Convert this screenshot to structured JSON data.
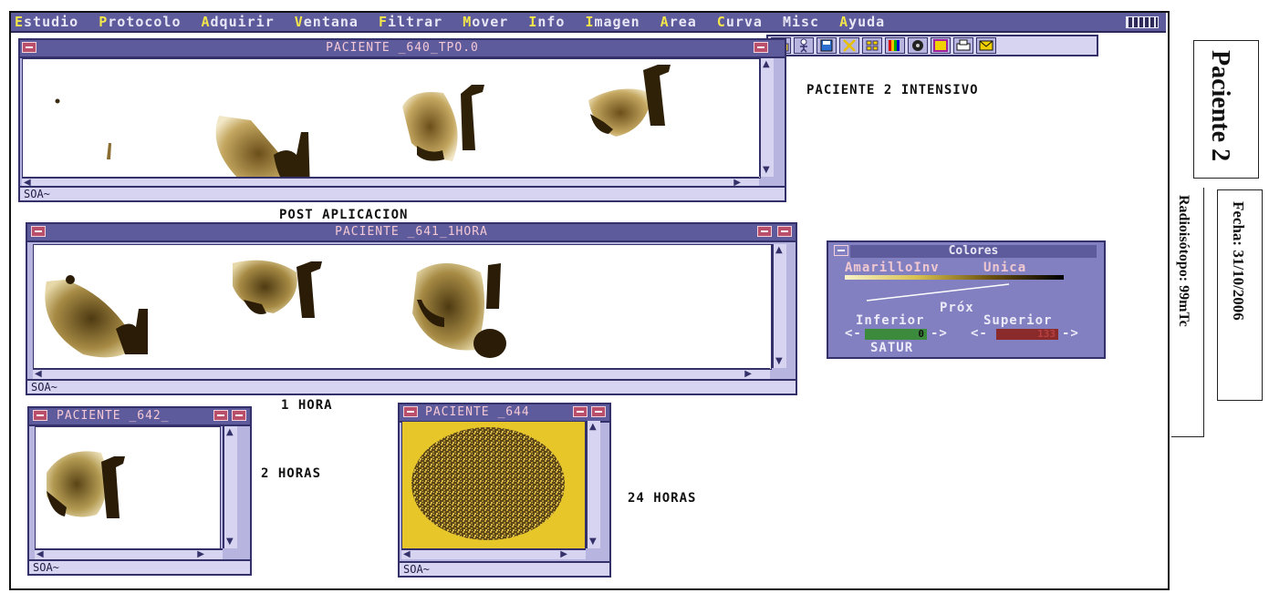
{
  "menubar": {
    "items": [
      {
        "hot": "E",
        "rest": "studio"
      },
      {
        "hot": "P",
        "rest": "rotocolo"
      },
      {
        "hot": "A",
        "rest": "dquirir"
      },
      {
        "hot": "V",
        "rest": "entana"
      },
      {
        "hot": "F",
        "rest": "iltrar"
      },
      {
        "hot": "M",
        "rest": "over"
      },
      {
        "hot": "I",
        "rest": "nfo"
      },
      {
        "hot": "I",
        "rest": "magen"
      },
      {
        "hot": "A",
        "rest": "rea"
      },
      {
        "hot": "C",
        "rest": "urva"
      },
      {
        "hot": "",
        "rest": "Misc"
      },
      {
        "hot": "A",
        "rest": "yuda"
      }
    ]
  },
  "toolbar": {
    "icons": [
      "folder-open-icon",
      "person-icon",
      "save-disk-icon",
      "close-x-icon",
      "grid-icon",
      "color-bars-icon",
      "film-reel-icon",
      "brain-icon",
      "printer-icon",
      "mail-icon"
    ]
  },
  "windows": {
    "w640": {
      "title": "PACIENTE _640_TPO.0",
      "status": "SOA~"
    },
    "w641": {
      "title": "PACIENTE _641_1HORA",
      "status": "SOA~"
    },
    "w642": {
      "title": "PACIENTE _642_",
      "status": "SOA~"
    },
    "w644": {
      "title": "PACIENTE _644",
      "status": "SOA~"
    }
  },
  "labels": {
    "header": "PACIENTE 2 INTENSIVO",
    "post": "POST APLICACION",
    "one_hour": "1 HORA",
    "two_hours": "2 HORAS",
    "twenty_four": "24 HORAS"
  },
  "colores": {
    "title": "Colores",
    "palette": "AmarilloInv",
    "mode": "Unica",
    "prox": "Próx",
    "inferior": "Inferior",
    "superior": "Superior",
    "inferior_value": "0",
    "superior_value": "133",
    "satur": "SATUR"
  },
  "side": {
    "patient": "Paciente 2",
    "fecha": "Fecha: 31/10/2006",
    "radioisotopo": "Radioisótopo: 99mTc"
  },
  "colors": {
    "menu_bg": "#5e5b9c",
    "window_frame": "#b7b4e0",
    "hotkey": "#f2e64a",
    "scan": "#3a2a10"
  }
}
